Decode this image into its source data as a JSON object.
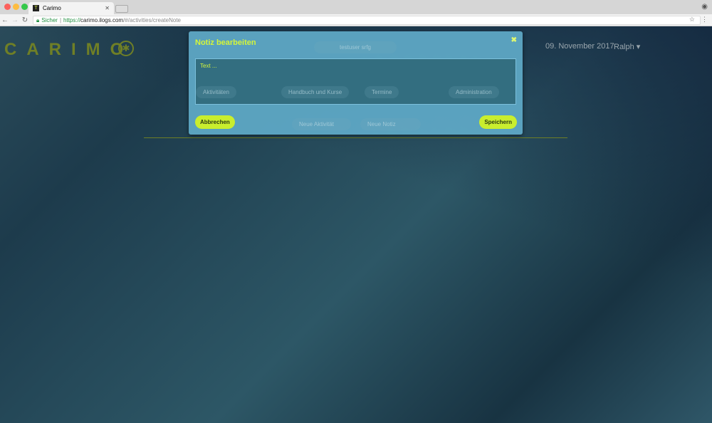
{
  "browser": {
    "tab_title": "Carimo",
    "favicon": "T",
    "secure_label": "Sicher",
    "url_scheme": "https://",
    "url_host": "carimo.ilogs.com",
    "url_path": "/#/activities/createNote"
  },
  "header": {
    "logo": "CARIMO",
    "date": "09. November 2017",
    "user": "Ralph ▾"
  },
  "background": {
    "user_pill": "testuser srfg",
    "nav": [
      "Aktivitäten",
      "Handbuch und Kurse",
      "Termine",
      "Administration"
    ],
    "actions": [
      "Neue Aktivität",
      "Neue Notiz"
    ]
  },
  "modal": {
    "title": "Notiz bearbeiten",
    "close": "✖",
    "text_value": "Text ...",
    "cancel": "Abbrechen",
    "save": "Speichern"
  },
  "colors": {
    "accent": "#c9ee2e",
    "title": "#d4f53a",
    "logo": "#6f7f26"
  }
}
